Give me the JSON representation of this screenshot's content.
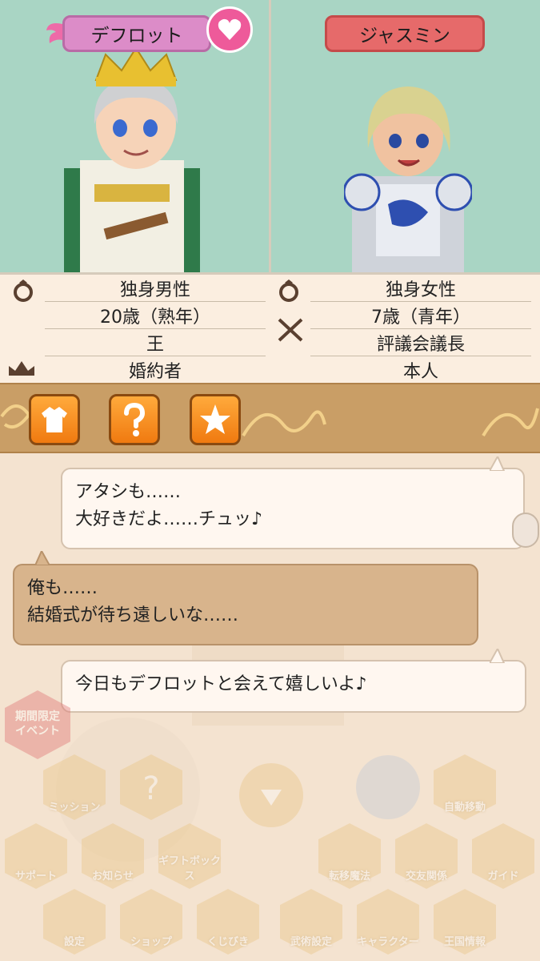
{
  "left_character": {
    "name": "デフロット",
    "status": "独身男性",
    "age": "20歳（熟年）",
    "title": "王",
    "relation": "婚約者"
  },
  "right_character": {
    "name": "ジャスミン",
    "status": "独身女性",
    "age": "7歳（青年）",
    "title": "評議会議長",
    "relation": "本人"
  },
  "icons": {
    "heart": "heart-icon",
    "ring": "ring-icon",
    "crown": "crown-icon",
    "swords": "crossed-swords-icon",
    "outfit": "outfit-icon",
    "question": "question-icon",
    "star": "star-icon"
  },
  "chat": {
    "message1": [
      "アタシも……",
      "大好きだよ……チュッ♪"
    ],
    "message2": [
      "俺も……",
      "結婚式が待ち遠しいな……"
    ],
    "message3": "今日もデフロットと会えて嬉しいよ♪"
  },
  "menu": {
    "event": [
      "期間限定",
      "イベント"
    ],
    "items": {
      "mission": "ミッション",
      "auto_move": "自動移動",
      "support": "サポート",
      "notice": "お知らせ",
      "gift_box": "ギフトボックス",
      "teleport": "転移魔法",
      "friends": "交友関係",
      "guide": "ガイド",
      "settings": "設定",
      "shop": "ショップ",
      "lottery": "くじびき",
      "equipment": "武術設定",
      "character": "キャラクター",
      "kingdom": "王国情報"
    }
  },
  "colors": {
    "portrait_bg": "#a9d5c4",
    "name_left": "#dc8cc8",
    "name_right": "#e66a6a",
    "heart": "#ee5a9a",
    "tab_orange": "#f07a10",
    "ornament": "#c99e66"
  }
}
